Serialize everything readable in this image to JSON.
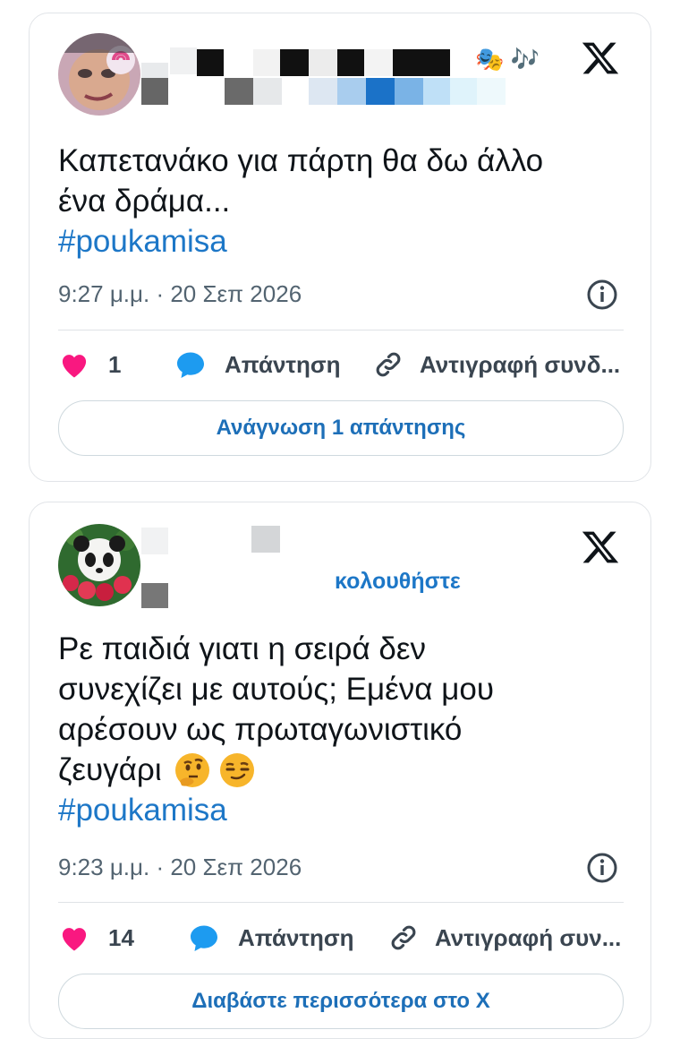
{
  "tweets": [
    {
      "text_lines": [
        "Καπετανάκο για πάρτη  θα δω άλλο",
        "ένα δράμα..."
      ],
      "hashtag": "#poukamisa",
      "meta": "9:27 μ.μ. · 20 Σεπ 2026",
      "likes": "1",
      "reply_label": "Απάντηση",
      "copy_label": "Αντιγραφή συνδ...",
      "cta_label": "Ανάγνωση 1 απάντησης",
      "name_emoji": "🎭 🎶"
    },
    {
      "follow_label": "κολουθήστε",
      "text_lines": [
        "Ρε παιδιά γιατι η σειρά δεν",
        "συνεχίζει με αυτούς; Εμένα μου",
        "αρέσουν ως πρωταγωνιστικό",
        "ζευγάρι"
      ],
      "hashtag": "#poukamisa",
      "meta": "9:23 μ.μ. · 20 Σεπ 2026",
      "likes": "14",
      "reply_label": "Απάντηση",
      "copy_label": "Αντιγραφή συν...",
      "cta_label": "Διαβάστε περισσότερα στο X"
    }
  ],
  "colors": {
    "like": "#f91880",
    "reply": "#1d9bf0",
    "link": "#1d77c7",
    "cta_text": "#1d6fb8",
    "muted": "#536471"
  },
  "icons": [
    "x-logo-icon",
    "heart-icon",
    "comment-bubble-icon",
    "link-chain-icon",
    "info-icon",
    "thinking-face-emoji",
    "smirking-face-emoji"
  ]
}
